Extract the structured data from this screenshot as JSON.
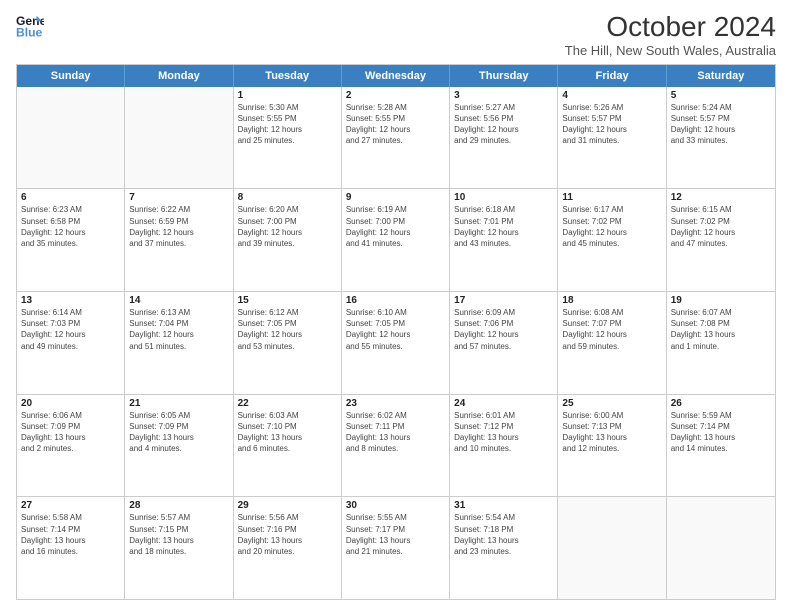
{
  "logo": {
    "line1": "General",
    "line2": "Blue"
  },
  "title": "October 2024",
  "subtitle": "The Hill, New South Wales, Australia",
  "headers": [
    "Sunday",
    "Monday",
    "Tuesday",
    "Wednesday",
    "Thursday",
    "Friday",
    "Saturday"
  ],
  "weeks": [
    [
      {
        "day": "",
        "info": ""
      },
      {
        "day": "",
        "info": ""
      },
      {
        "day": "1",
        "info": "Sunrise: 5:30 AM\nSunset: 5:55 PM\nDaylight: 12 hours\nand 25 minutes."
      },
      {
        "day": "2",
        "info": "Sunrise: 5:28 AM\nSunset: 5:55 PM\nDaylight: 12 hours\nand 27 minutes."
      },
      {
        "day": "3",
        "info": "Sunrise: 5:27 AM\nSunset: 5:56 PM\nDaylight: 12 hours\nand 29 minutes."
      },
      {
        "day": "4",
        "info": "Sunrise: 5:26 AM\nSunset: 5:57 PM\nDaylight: 12 hours\nand 31 minutes."
      },
      {
        "day": "5",
        "info": "Sunrise: 5:24 AM\nSunset: 5:57 PM\nDaylight: 12 hours\nand 33 minutes."
      }
    ],
    [
      {
        "day": "6",
        "info": "Sunrise: 6:23 AM\nSunset: 6:58 PM\nDaylight: 12 hours\nand 35 minutes."
      },
      {
        "day": "7",
        "info": "Sunrise: 6:22 AM\nSunset: 6:59 PM\nDaylight: 12 hours\nand 37 minutes."
      },
      {
        "day": "8",
        "info": "Sunrise: 6:20 AM\nSunset: 7:00 PM\nDaylight: 12 hours\nand 39 minutes."
      },
      {
        "day": "9",
        "info": "Sunrise: 6:19 AM\nSunset: 7:00 PM\nDaylight: 12 hours\nand 41 minutes."
      },
      {
        "day": "10",
        "info": "Sunrise: 6:18 AM\nSunset: 7:01 PM\nDaylight: 12 hours\nand 43 minutes."
      },
      {
        "day": "11",
        "info": "Sunrise: 6:17 AM\nSunset: 7:02 PM\nDaylight: 12 hours\nand 45 minutes."
      },
      {
        "day": "12",
        "info": "Sunrise: 6:15 AM\nSunset: 7:02 PM\nDaylight: 12 hours\nand 47 minutes."
      }
    ],
    [
      {
        "day": "13",
        "info": "Sunrise: 6:14 AM\nSunset: 7:03 PM\nDaylight: 12 hours\nand 49 minutes."
      },
      {
        "day": "14",
        "info": "Sunrise: 6:13 AM\nSunset: 7:04 PM\nDaylight: 12 hours\nand 51 minutes."
      },
      {
        "day": "15",
        "info": "Sunrise: 6:12 AM\nSunset: 7:05 PM\nDaylight: 12 hours\nand 53 minutes."
      },
      {
        "day": "16",
        "info": "Sunrise: 6:10 AM\nSunset: 7:05 PM\nDaylight: 12 hours\nand 55 minutes."
      },
      {
        "day": "17",
        "info": "Sunrise: 6:09 AM\nSunset: 7:06 PM\nDaylight: 12 hours\nand 57 minutes."
      },
      {
        "day": "18",
        "info": "Sunrise: 6:08 AM\nSunset: 7:07 PM\nDaylight: 12 hours\nand 59 minutes."
      },
      {
        "day": "19",
        "info": "Sunrise: 6:07 AM\nSunset: 7:08 PM\nDaylight: 13 hours\nand 1 minute."
      }
    ],
    [
      {
        "day": "20",
        "info": "Sunrise: 6:06 AM\nSunset: 7:09 PM\nDaylight: 13 hours\nand 2 minutes."
      },
      {
        "day": "21",
        "info": "Sunrise: 6:05 AM\nSunset: 7:09 PM\nDaylight: 13 hours\nand 4 minutes."
      },
      {
        "day": "22",
        "info": "Sunrise: 6:03 AM\nSunset: 7:10 PM\nDaylight: 13 hours\nand 6 minutes."
      },
      {
        "day": "23",
        "info": "Sunrise: 6:02 AM\nSunset: 7:11 PM\nDaylight: 13 hours\nand 8 minutes."
      },
      {
        "day": "24",
        "info": "Sunrise: 6:01 AM\nSunset: 7:12 PM\nDaylight: 13 hours\nand 10 minutes."
      },
      {
        "day": "25",
        "info": "Sunrise: 6:00 AM\nSunset: 7:13 PM\nDaylight: 13 hours\nand 12 minutes."
      },
      {
        "day": "26",
        "info": "Sunrise: 5:59 AM\nSunset: 7:14 PM\nDaylight: 13 hours\nand 14 minutes."
      }
    ],
    [
      {
        "day": "27",
        "info": "Sunrise: 5:58 AM\nSunset: 7:14 PM\nDaylight: 13 hours\nand 16 minutes."
      },
      {
        "day": "28",
        "info": "Sunrise: 5:57 AM\nSunset: 7:15 PM\nDaylight: 13 hours\nand 18 minutes."
      },
      {
        "day": "29",
        "info": "Sunrise: 5:56 AM\nSunset: 7:16 PM\nDaylight: 13 hours\nand 20 minutes."
      },
      {
        "day": "30",
        "info": "Sunrise: 5:55 AM\nSunset: 7:17 PM\nDaylight: 13 hours\nand 21 minutes."
      },
      {
        "day": "31",
        "info": "Sunrise: 5:54 AM\nSunset: 7:18 PM\nDaylight: 13 hours\nand 23 minutes."
      },
      {
        "day": "",
        "info": ""
      },
      {
        "day": "",
        "info": ""
      }
    ]
  ]
}
